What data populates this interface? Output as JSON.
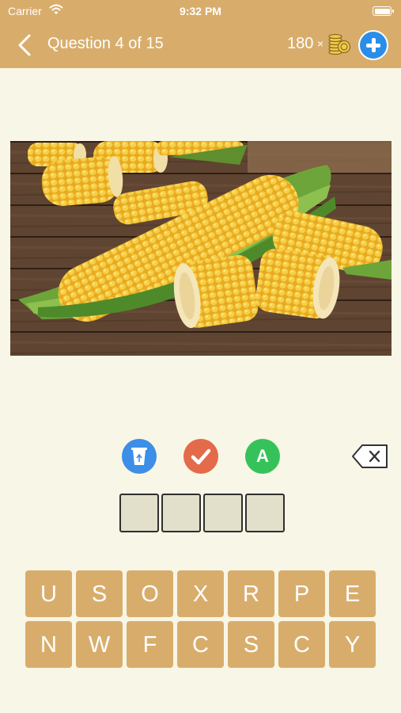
{
  "status_bar": {
    "carrier": "Carrier",
    "time": "9:32 PM"
  },
  "header": {
    "back_icon": "chevron-left-icon",
    "title": "Question 4 of 15",
    "coins": "180",
    "coins_multiplier": "×",
    "coin_icon": "coin-stack-icon",
    "add_coins_icon": "plus-circle-icon",
    "bar_color": "#d8ad6c"
  },
  "picture": {
    "subject": "corn on the cob on wooden table"
  },
  "hints": {
    "remove_letters_icon": "recycle-bin-icon",
    "reveal_letter_icon": "check-icon",
    "show_answer_label": "A",
    "backspace_icon": "backspace-icon"
  },
  "answer_slots": [
    "",
    "",
    "",
    ""
  ],
  "keyboard": {
    "row1": [
      "U",
      "S",
      "O",
      "X",
      "R",
      "P",
      "E"
    ],
    "row2": [
      "N",
      "W",
      "F",
      "C",
      "S",
      "C",
      "Y"
    ]
  },
  "colors": {
    "background": "#f8f6e6",
    "key": "#d8ad6c",
    "hint_blue": "#3c8ee6",
    "hint_red": "#e36a4a",
    "hint_green": "#36c25a"
  }
}
